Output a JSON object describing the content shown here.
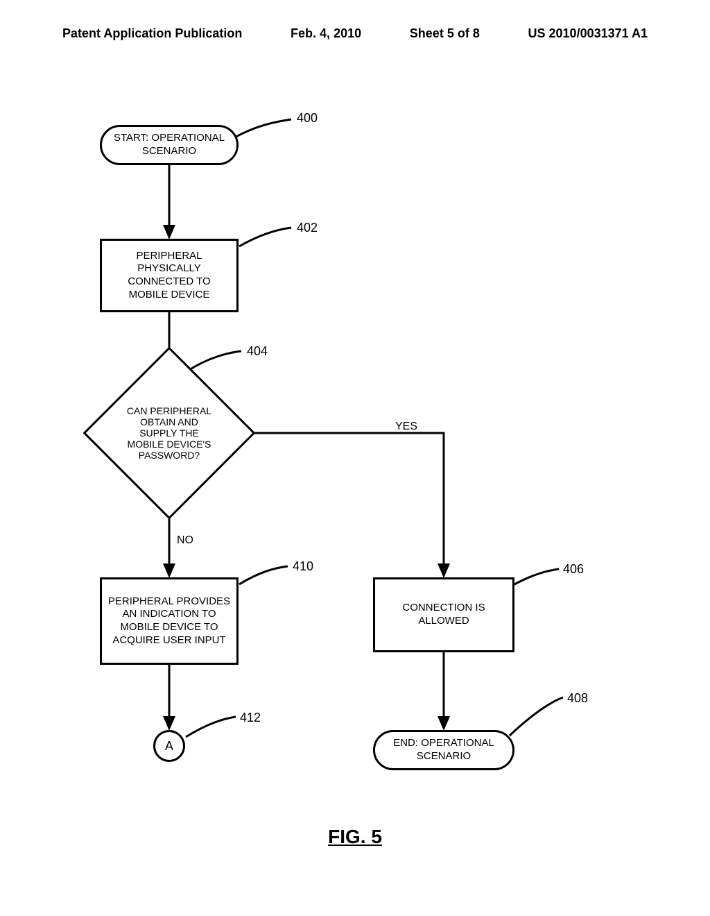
{
  "header": {
    "publication_type": "Patent Application Publication",
    "date": "Feb. 4, 2010",
    "sheet": "Sheet 5 of 8",
    "publication_number": "US 2010/0031371 A1"
  },
  "figure_label": "FIG. 5",
  "nodes": {
    "start": {
      "text": "START: OPERATIONAL SCENARIO",
      "ref": "400"
    },
    "step_connect": {
      "text": "PERIPHERAL PHYSICALLY CONNECTED TO MOBILE DEVICE",
      "ref": "402"
    },
    "decision": {
      "text": "CAN PERIPHERAL OBTAIN AND SUPPLY THE MOBILE DEVICE'S PASSWORD?",
      "ref": "404"
    },
    "step_indicate": {
      "text": "PERIPHERAL PROVIDES AN INDICATION TO MOBILE DEVICE TO ACQUIRE USER INPUT",
      "ref": "410"
    },
    "step_allowed": {
      "text": "CONNECTION IS ALLOWED",
      "ref": "406"
    },
    "end": {
      "text": "END: OPERATIONAL SCENARIO",
      "ref": "408"
    },
    "connector_a": {
      "text": "A",
      "ref": "412"
    }
  },
  "edge_labels": {
    "yes": "YES",
    "no": "NO"
  }
}
